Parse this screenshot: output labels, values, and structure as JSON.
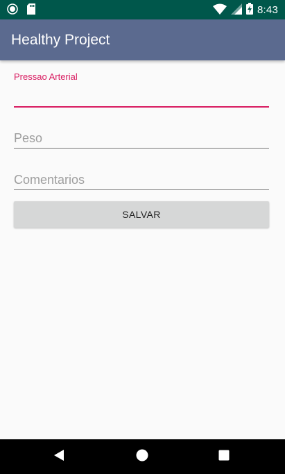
{
  "status_bar": {
    "time": "8:43",
    "left_icons": [
      "record-icon",
      "sd-card-icon"
    ],
    "right_icons": [
      "wifi-icon",
      "cell-signal-icon",
      "battery-charging-icon"
    ],
    "background": "#00574b"
  },
  "app_bar": {
    "title": "Healthy Project",
    "background": "#5b6a8f"
  },
  "form": {
    "pressure": {
      "label": "Pressao Arterial",
      "value": "",
      "focused": true
    },
    "weight": {
      "placeholder": "Peso",
      "value": ""
    },
    "comments": {
      "placeholder": "Comentarios",
      "value": ""
    },
    "accent_color": "#d81b60"
  },
  "actions": {
    "save_label": "SALVAR"
  },
  "nav_bar": {
    "icons": [
      "back-icon",
      "home-icon",
      "recents-icon"
    ]
  }
}
